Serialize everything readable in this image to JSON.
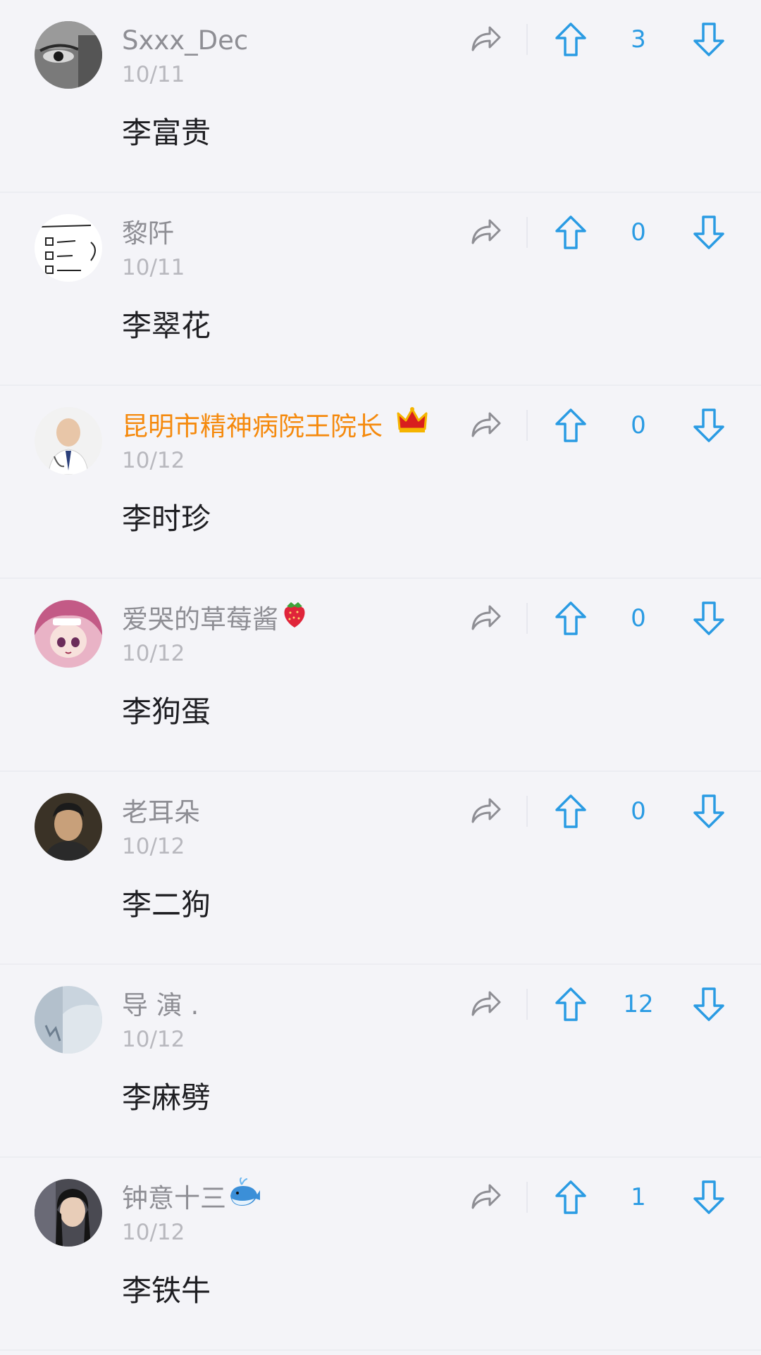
{
  "theme": {
    "background": "#f4f4f8",
    "accent_blue": "#2a9be3",
    "vip_orange": "#f58a0e",
    "name_gray": "#8e8e94",
    "date_gray": "#b8b8be"
  },
  "icons": {
    "share": "share-arrow-icon",
    "upvote": "arrow-up-icon",
    "downvote": "arrow-down-icon",
    "crown": "crown-emoji",
    "strawberry": "strawberry-emoji",
    "whale": "whale-emoji"
  },
  "comments": [
    {
      "username": "Sxxx_Dec",
      "date": "10/11",
      "text": "李富贵",
      "votes": "3",
      "avatar": "gray-eye-closeup"
    },
    {
      "username": "黎阡",
      "date": "10/11",
      "text": "李翠花",
      "votes": "0",
      "avatar": "handwritten-checklist-note"
    },
    {
      "username": "昆明市精神病院王院长",
      "date": "10/12",
      "text": "李时珍",
      "votes": "0",
      "avatar": "doctor-portrait",
      "vip": true,
      "badge": "crown-emoji"
    },
    {
      "username": "爱哭的草莓酱",
      "date": "10/12",
      "text": "李狗蛋",
      "votes": "0",
      "avatar": "anime-girl-pink-hair",
      "badge": "strawberry-emoji"
    },
    {
      "username": "老耳朵",
      "date": "10/12",
      "text": "李二狗",
      "votes": "0",
      "avatar": "man-portrait-dark"
    },
    {
      "username": "导 演 .",
      "date": "10/12",
      "text": "李麻劈",
      "votes": "12",
      "avatar": "pale-blue-scene"
    },
    {
      "username": "钟意十三",
      "date": "10/12",
      "text": "李铁牛",
      "votes": "1",
      "avatar": "girl-portrait-dark",
      "badge": "whale-emoji"
    }
  ]
}
